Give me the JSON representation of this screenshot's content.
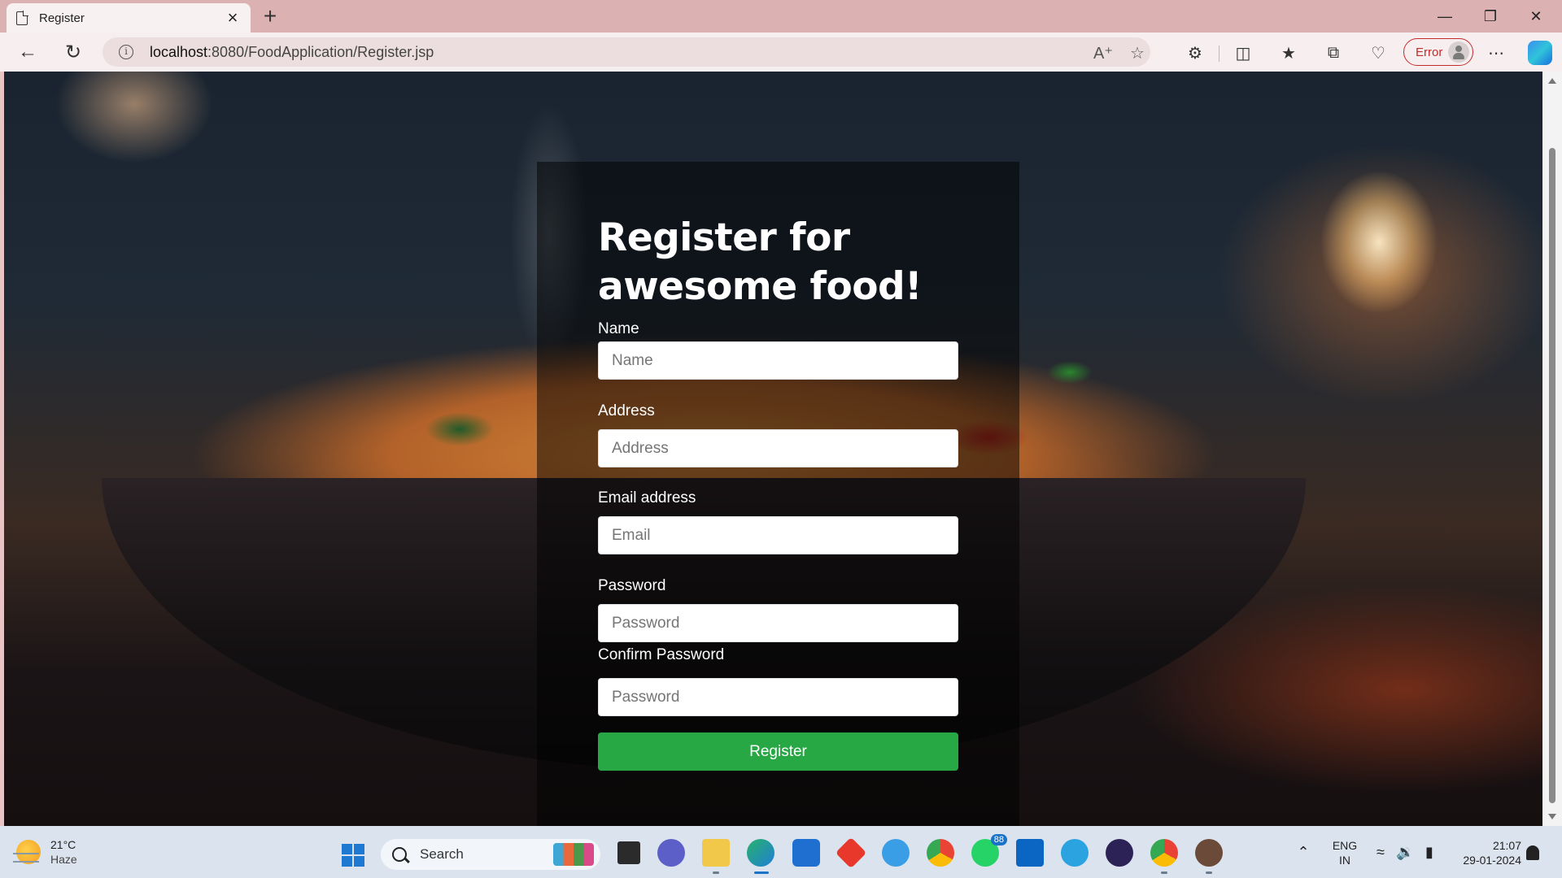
{
  "browser": {
    "tab_title": "Register",
    "url_host": "localhost",
    "url_rest": ":8080/FoodApplication/Register.jsp",
    "profile_status": "Error"
  },
  "form": {
    "heading_line1": "Register for",
    "heading_line2": "awesome food!",
    "fields": [
      {
        "label": "Name",
        "placeholder": "Name"
      },
      {
        "label": "Address",
        "placeholder": "Address"
      },
      {
        "label": "Email address",
        "placeholder": "Email"
      },
      {
        "label": "Password",
        "placeholder": "Password"
      },
      {
        "label": "Confirm Password",
        "placeholder": "Password"
      }
    ],
    "submit_label": "Register",
    "button_color": "#28a745"
  },
  "taskbar": {
    "weather_temp": "21°C",
    "weather_condition": "Haze",
    "search_label": "Search",
    "whatsapp_badge": "88",
    "lang_line1": "ENG",
    "lang_line2": "IN",
    "time": "21:07",
    "date": "29-01-2024"
  },
  "icons": [
    "page-icon",
    "close-icon",
    "plus-icon",
    "minimize-icon",
    "restore-icon",
    "back-icon",
    "refresh-icon",
    "info-icon",
    "read-aloud-icon",
    "favorite-star-icon",
    "extensions-icon",
    "split-screen-icon",
    "favorites-icon",
    "collections-icon",
    "browser-essentials-icon",
    "more-icon",
    "copilot-icon",
    "windows-start-icon",
    "search-icon",
    "chevron-up-icon",
    "wifi-icon",
    "volume-icon",
    "battery-icon",
    "bell-icon"
  ]
}
